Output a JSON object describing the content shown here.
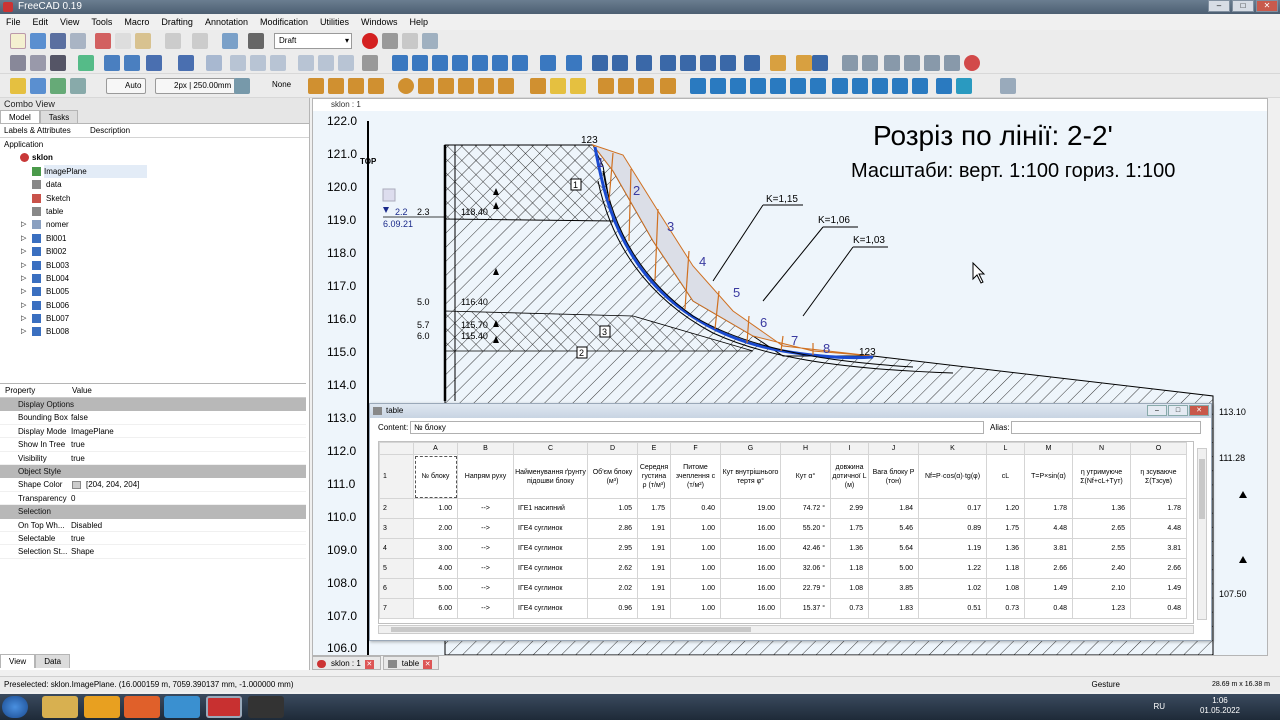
{
  "window": {
    "title": "FreeCAD 0.19"
  },
  "menu": [
    "File",
    "Edit",
    "View",
    "Tools",
    "Macro",
    "Drafting",
    "Annotation",
    "Modification",
    "Utilities",
    "Windows",
    "Help"
  ],
  "toolbar": {
    "workbench": "Draft",
    "auto_label": "Auto",
    "linewidth_label": "2px | 250.00mm",
    "none_label": "None"
  },
  "combo_view": {
    "title": "Combo View",
    "tabs": [
      "Model",
      "Tasks"
    ],
    "tree_headers": [
      "Labels & Attributes",
      "Description"
    ],
    "tree": [
      {
        "label": "Application",
        "level": 0
      },
      {
        "label": "sklon",
        "level": 1
      },
      {
        "label": "ImagePlane",
        "level": 2
      },
      {
        "label": "data",
        "level": 2
      },
      {
        "label": "Sketch",
        "level": 2
      },
      {
        "label": "table",
        "level": 2
      },
      {
        "label": "nomer",
        "level": 2
      },
      {
        "label": "Bl001",
        "level": 2
      },
      {
        "label": "Bl002",
        "level": 2
      },
      {
        "label": "BL003",
        "level": 2
      },
      {
        "label": "BL004",
        "level": 2
      },
      {
        "label": "BL005",
        "level": 2
      },
      {
        "label": "BL006",
        "level": 2
      },
      {
        "label": "BL007",
        "level": 2
      },
      {
        "label": "BL008",
        "level": 2
      }
    ],
    "prop_headers": [
      "Property",
      "Value"
    ],
    "properties": [
      {
        "group": "Display Options"
      },
      {
        "key": "Bounding Box",
        "value": "false"
      },
      {
        "key": "Display Mode",
        "value": "ImagePlane"
      },
      {
        "key": "Show In Tree",
        "value": "true"
      },
      {
        "key": "Visibility",
        "value": "true"
      },
      {
        "group": "Object Style"
      },
      {
        "key": "Shape Color",
        "value": "[204, 204, 204]"
      },
      {
        "key": "Transparency",
        "value": "0"
      },
      {
        "group": "Selection"
      },
      {
        "key": "On Top Wh...",
        "value": "Disabled"
      },
      {
        "key": "Selectable",
        "value": "true"
      },
      {
        "key": "Selection St...",
        "value": "Shape"
      }
    ],
    "bottom_tabs": [
      "View",
      "Data"
    ]
  },
  "view": {
    "tab_title": "sklon : 1",
    "nav_cube": "TOP",
    "heading": "Розріз по лінії: 2-2'",
    "scale_text": "Масштаби: верт. 1:100 гориз. 1:100",
    "y_ticks": [
      "122.0",
      "121.0",
      "120.0",
      "119.0",
      "118.0",
      "117.0",
      "116.0",
      "115.0",
      "114.0",
      "113.0",
      "112.0",
      "111.0",
      "110.0",
      "109.0",
      "108.0",
      "107.0",
      "106.0"
    ],
    "labels": {
      "top_point": "123",
      "end_point": "123",
      "k1": "K=1,15",
      "k2": "K=1,06",
      "k3": "K=1,03",
      "water": "2.2",
      "water_date": "6.09.21",
      "d23": "2.3",
      "e1": "118.40",
      "d50": "5.0",
      "e2": "116.40",
      "d57": "5.7",
      "e3": "115.70",
      "d60": "6.0",
      "e4": "115.40",
      "r1": "113.10",
      "r2": "111.28",
      "r3": "107.50",
      "soil1": "1",
      "soil2": "2",
      "soil3": "3"
    },
    "blocks": [
      "1",
      "2",
      "3",
      "4",
      "5",
      "6",
      "7",
      "8"
    ]
  },
  "table_window": {
    "title": "table",
    "content_label": "Content:",
    "content_value": "№ блоку",
    "alias_label": "Alias:",
    "columns": [
      "A",
      "B",
      "C",
      "D",
      "E",
      "F",
      "G",
      "H",
      "I",
      "J",
      "K",
      "L",
      "M",
      "N",
      "O"
    ],
    "headers": [
      "№ блоку",
      "Напрям руху",
      "Найменування ґрунту підошви блоку",
      "Об'єм блоку (м³)",
      "Середня густина ρ (т/м³)",
      "Питоме зчеплення с (т/м²)",
      "Кут внутрішнього тертя φ°",
      "Кут α°",
      "довжина дотичної L (м)",
      "Вага блоку P (тон)",
      "Nf=P·cos(α)·tg(φ)",
      "cL",
      "T=P×sin(α)",
      "η утримуючe Σ(Nf+cL+Tут)",
      "η зсуваючe Σ(Tзсув)"
    ],
    "rows": [
      [
        "2",
        "1.00",
        "-->",
        "ІГЕ1 насипний",
        "1.05",
        "1.75",
        "0.40",
        "19.00",
        "74.72 °",
        "2.99",
        "1.84",
        "0.17",
        "1.20",
        "1.78",
        "1.36",
        "1.78"
      ],
      [
        "3",
        "2.00",
        "-->",
        "ІГЕ4 суглинок",
        "2.86",
        "1.91",
        "1.00",
        "16.00",
        "55.20 °",
        "1.75",
        "5.46",
        "0.89",
        "1.75",
        "4.48",
        "2.65",
        "4.48"
      ],
      [
        "4",
        "3.00",
        "-->",
        "ІГЕ4 суглинок",
        "2.95",
        "1.91",
        "1.00",
        "16.00",
        "42.46 °",
        "1.36",
        "5.64",
        "1.19",
        "1.36",
        "3.81",
        "2.55",
        "3.81"
      ],
      [
        "5",
        "4.00",
        "-->",
        "ІГЕ4 суглинок",
        "2.62",
        "1.91",
        "1.00",
        "16.00",
        "32.06 °",
        "1.18",
        "5.00",
        "1.22",
        "1.18",
        "2.66",
        "2.40",
        "2.66"
      ],
      [
        "6",
        "5.00",
        "-->",
        "ІГЕ4 суглинок",
        "2.02",
        "1.91",
        "1.00",
        "16.00",
        "22.79 °",
        "1.08",
        "3.85",
        "1.02",
        "1.08",
        "1.49",
        "2.10",
        "1.49"
      ],
      [
        "7",
        "6.00",
        "-->",
        "ІГЕ4 суглинок",
        "0.96",
        "1.91",
        "1.00",
        "16.00",
        "15.37 °",
        "0.73",
        "1.83",
        "0.51",
        "0.73",
        "0.48",
        "1.23",
        "0.48"
      ]
    ]
  },
  "doc_tabs": [
    "sklon : 1",
    "table"
  ],
  "status": {
    "text": "Preselected: sklon.ImagePlane. (16.000159 m, 7059.390137 mm, -1.000000 mm)",
    "nav": "Gesture",
    "dims": "28.69 m x 16.38 m"
  },
  "taskbar": {
    "lang": "RU",
    "time": "1:06",
    "date": "01.05.2022"
  }
}
